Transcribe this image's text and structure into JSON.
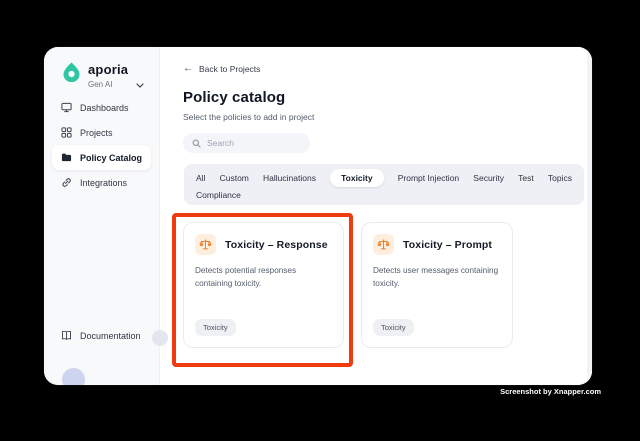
{
  "sidebar": {
    "brand": "aporia",
    "workspace": "Gen AI",
    "items": [
      {
        "label": "Dashboards"
      },
      {
        "label": "Projects"
      },
      {
        "label": "Policy Catalog"
      },
      {
        "label": "Integrations"
      }
    ],
    "footer_item": {
      "label": "Documentation"
    }
  },
  "header": {
    "back_link": "Back to Projects",
    "back_arrow": "←",
    "title": "Policy catalog",
    "subtitle": "Select the policies to add in project"
  },
  "search": {
    "placeholder": "Search"
  },
  "tabs": {
    "items": [
      {
        "label": "All"
      },
      {
        "label": "Custom"
      },
      {
        "label": "Hallucinations"
      },
      {
        "label": "Toxicity",
        "active": true
      },
      {
        "label": "Prompt Injection"
      },
      {
        "label": "Security"
      },
      {
        "label": "Test"
      },
      {
        "label": "Topics"
      },
      {
        "label": "Compliance"
      }
    ]
  },
  "cards": [
    {
      "title": "Toxicity – Response",
      "description": "Detects potential responses containing toxicity.",
      "tag": "Toxicity",
      "icon": "scales-icon",
      "highlighted": true
    },
    {
      "title": "Toxicity – Prompt",
      "description": "Detects user messages containing toxicity.",
      "tag": "Toxicity",
      "icon": "scales-icon",
      "highlighted": false
    }
  ],
  "watermark": "Screenshot by Xnapper.com",
  "colors": {
    "highlight_red": "#f03a10",
    "brand_teal": "#2fc6a2",
    "icon_orange": "#ed8330",
    "icon_orange_bg": "#fdeedd",
    "sidebar_bg": "#f8f9fb",
    "tabs_bg": "#eef0f6"
  }
}
